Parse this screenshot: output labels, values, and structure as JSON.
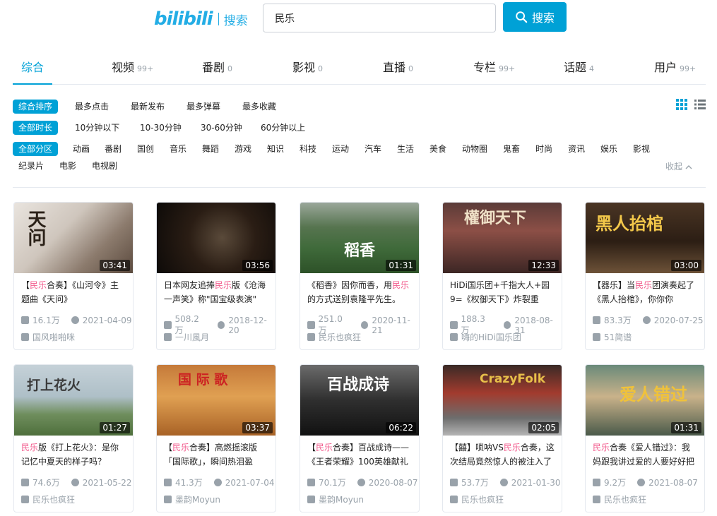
{
  "header": {
    "logo": "bilibili",
    "logo_suffix": "搜索",
    "search_value": "民乐",
    "search_button": "搜索"
  },
  "tabs": [
    {
      "label": "综合",
      "count": ""
    },
    {
      "label": "视频",
      "count": "99+"
    },
    {
      "label": "番剧",
      "count": "0"
    },
    {
      "label": "影视",
      "count": "0"
    },
    {
      "label": "直播",
      "count": "0"
    },
    {
      "label": "专栏",
      "count": "99+"
    },
    {
      "label": "话题",
      "count": "4"
    },
    {
      "label": "用户",
      "count": "99+"
    }
  ],
  "sort": {
    "active": "综合排序",
    "options": [
      "最多点击",
      "最新发布",
      "最多弹幕",
      "最多收藏"
    ]
  },
  "duration": {
    "active": "全部时长",
    "options": [
      "10分钟以下",
      "10-30分钟",
      "30-60分钟",
      "60分钟以上"
    ]
  },
  "zones": {
    "active": "全部分区",
    "row1": [
      "动画",
      "番剧",
      "国创",
      "音乐",
      "舞蹈",
      "游戏",
      "知识",
      "科技",
      "运动",
      "汽车",
      "生活",
      "美食",
      "动物圈",
      "鬼畜",
      "时尚",
      "资讯",
      "娱乐",
      "影视"
    ],
    "row2": [
      "纪录片",
      "电影",
      "电视剧"
    ],
    "collapse": "收起"
  },
  "videos": [
    {
      "thumb_text": "天问",
      "duration": "03:41",
      "t1": "【",
      "hl": "民乐",
      "t2": "合奏】《山河令》主题曲《天问》",
      "views": "16.1万",
      "date": "2021-04-09",
      "up": "国风啪啪咪"
    },
    {
      "thumb_text": "",
      "duration": "03:56",
      "t1": "日本网友追捧",
      "hl": "民乐",
      "t2": "版《沧海一声笑》称\"国宝级表演\"",
      "views": "508.2万",
      "date": "2018-12-20",
      "up": "一川風月"
    },
    {
      "thumb_text": "稻香",
      "duration": "01:31",
      "t1": "《稻香》因你而香，用",
      "hl": "民乐",
      "t2": "的方式送别袁隆平先生。",
      "views": "251.0万",
      "date": "2020-11-21",
      "up": "民乐也疯狂"
    },
    {
      "thumb_text": "權御天下",
      "duration": "12:33",
      "t1": "HiDi国乐团+千指大人+园9=《权御天下》炸裂重",
      "hl": "",
      "t2": "",
      "views": "188.3万",
      "date": "2018-08-31",
      "up": "嗨的HiDi国乐团"
    },
    {
      "thumb_text": "黑人抬棺",
      "duration": "03:00",
      "t1": "【器乐】当",
      "hl": "民乐",
      "t2": "团演奏起了《黑人抬棺》，你你你",
      "views": "83.3万",
      "date": "2020-07-25",
      "up": "51简谱"
    },
    {
      "thumb_text": "打上花火",
      "duration": "01:27",
      "t1": "",
      "hl": "民乐",
      "t2": "版《打上花火》：是你记忆中夏天的样子吗？",
      "views": "74.6万",
      "date": "2021-05-22",
      "up": "民乐也疯狂"
    },
    {
      "thumb_text": "国 际 歌",
      "duration": "03:37",
      "t1": "【",
      "hl": "民乐",
      "t2": "合奏】高燃摇滚版「国际歌」，瞬间热泪盈",
      "views": "41.3万",
      "date": "2021-07-04",
      "up": "墨韵Moyun"
    },
    {
      "thumb_text": "百战成诗",
      "duration": "06:22",
      "t1": "【",
      "hl": "民乐",
      "t2": "合奏】百战成诗——《王者荣耀》100英雄献礼",
      "views": "70.1万",
      "date": "2020-08-07",
      "up": "墨韵Moyun"
    },
    {
      "thumb_text": "CrazyFolk",
      "duration": "02:05",
      "t1": "【囍】唢呐VS",
      "hl": "民乐",
      "t2": "合奏，这次结局竟然惊人的被注入了",
      "views": "53.7万",
      "date": "2021-01-30",
      "up": "民乐也疯狂"
    },
    {
      "thumb_text": "爱人错过",
      "duration": "01:31",
      "t1": "",
      "hl": "民乐",
      "t2": "合奏《爱人错过》：我妈跟我讲过爱的人要好好把",
      "views": "9.2万",
      "date": "2021-08-07",
      "up": "民乐也疯狂"
    }
  ],
  "colors": {
    "accent": "#00a1d6",
    "highlight": "#f25d8e",
    "meta": "#99a2aa"
  }
}
